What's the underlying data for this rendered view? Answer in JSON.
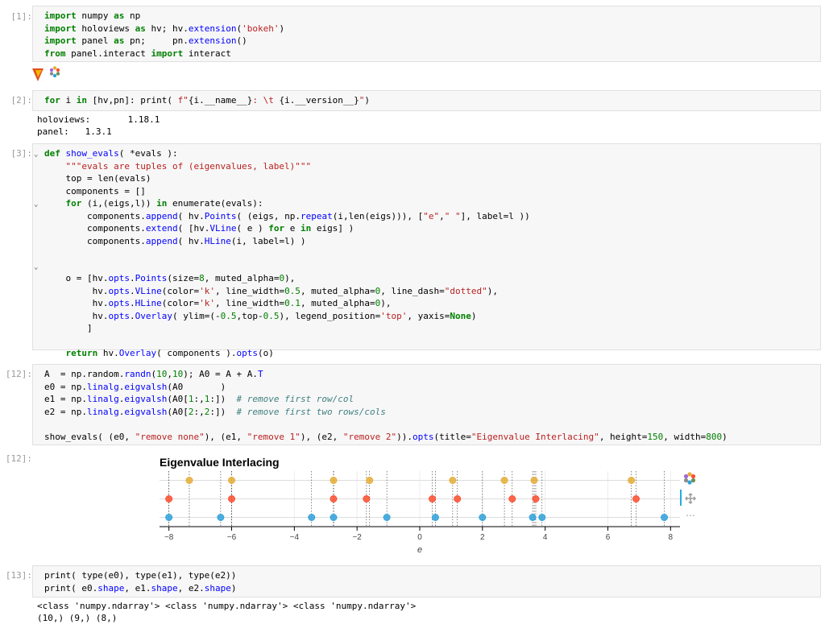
{
  "cells": [
    {
      "prompt": "[1]:"
    },
    {
      "prompt": "[2]:"
    },
    {
      "prompt": "[3]:"
    },
    {
      "prompt": "[12]:"
    },
    {
      "prompt": "[12]:"
    },
    {
      "prompt": "[13]:"
    }
  ],
  "cell2_output": [
    "holoviews:       1.18.1",
    "panel:   1.3.1"
  ],
  "cell13_output": [
    "<class 'numpy.ndarray'> <class 'numpy.ndarray'> <class 'numpy.ndarray'>",
    "(10,) (9,) (8,)"
  ],
  "toolbar": {
    "icons": [
      "bokeh-logo-icon",
      "pan-move-icon",
      "more-dots-icon"
    ],
    "more_label": "⋯"
  },
  "colors": {
    "remove_none": "#30a2da",
    "remove_1": "#fc4f30",
    "remove_2": "#e5ae38"
  },
  "chart_data": {
    "type": "scatter",
    "title": "Eigenvalue Interlacing",
    "xlabel": "e",
    "xlim": [
      -8.3,
      8.3
    ],
    "ylim": [
      -0.5,
      2.5
    ],
    "xticks": [
      -8,
      -6,
      -4,
      -2,
      0,
      2,
      4,
      6,
      8
    ],
    "grid": true,
    "series": [
      {
        "name": "remove none",
        "y": 0,
        "values": [
          -8.0,
          -6.35,
          -3.45,
          -2.75,
          -1.05,
          0.5,
          2.0,
          3.6,
          3.9,
          7.8
        ]
      },
      {
        "name": "remove 1",
        "y": 1,
        "values": [
          -8.0,
          -6.0,
          -2.75,
          -1.7,
          0.4,
          1.2,
          2.95,
          3.7,
          6.9
        ]
      },
      {
        "name": "remove 2",
        "y": 2,
        "values": [
          -7.35,
          -6.0,
          -2.75,
          -1.6,
          1.05,
          2.7,
          3.65,
          6.75
        ]
      }
    ]
  }
}
